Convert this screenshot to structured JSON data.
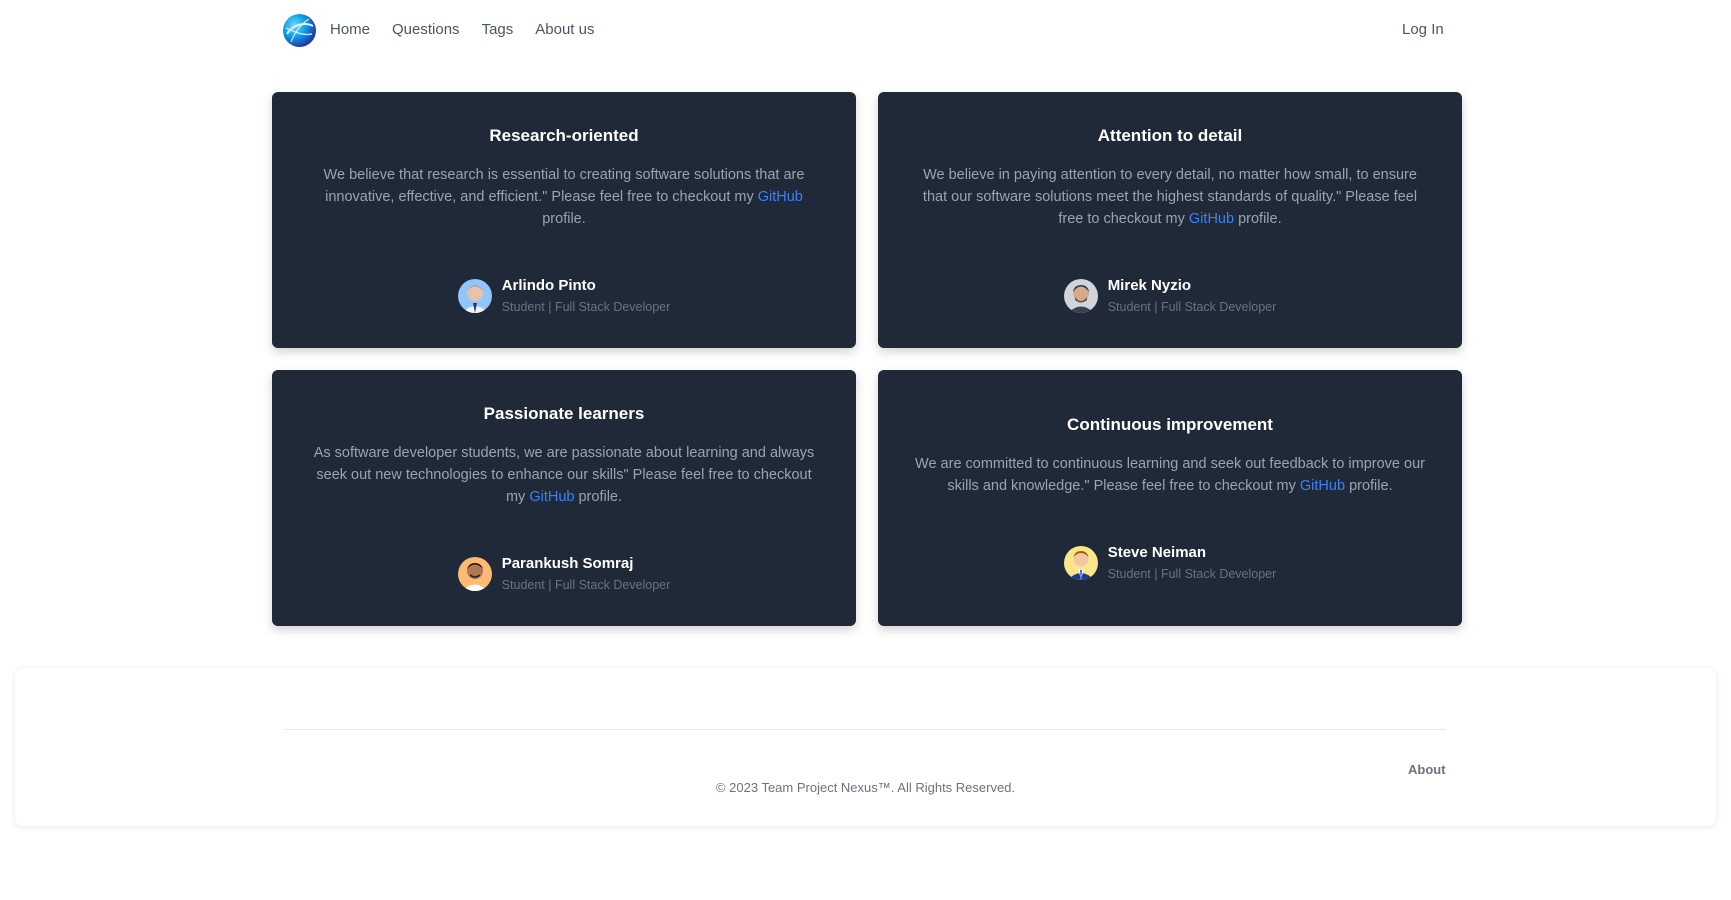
{
  "nav": {
    "logo_name": "globe-logo",
    "links": [
      "Home",
      "Questions",
      "Tags",
      "About us"
    ],
    "login": "Log In"
  },
  "cards": [
    {
      "title": "Research-oriented",
      "quote_before": "We believe that research is essential to creating software solutions that are innovative, effective, and efficient.\" Please feel free to checkout my ",
      "link_text": "GitHub",
      "quote_after": " profile.",
      "author_name": "Arlindo Pinto",
      "author_role": "Student | Full Stack Developer"
    },
    {
      "title": "Attention to detail",
      "quote_before": "We believe in paying attention to every detail, no matter how small, to ensure that our software solutions meet the highest standards of quality.\" Please feel free to checkout my ",
      "link_text": "GitHub",
      "quote_after": " profile.",
      "author_name": "Mirek Nyzio",
      "author_role": "Student | Full Stack Developer"
    },
    {
      "title": "Passionate learners",
      "quote_before": "As software developer students, we are passionate about learning and always seek out new technologies to enhance our skills\" Please feel free to checkout my ",
      "link_text": "GitHub",
      "quote_after": " profile.",
      "author_name": "Parankush Somraj",
      "author_role": "Student | Full Stack Developer"
    },
    {
      "title": "Continuous improvement",
      "quote_before": "We are committed to continuous learning and seek out feedback to improve our skills and knowledge.\" Please feel free to checkout my ",
      "link_text": "GitHub",
      "quote_after": " profile.",
      "author_name": "Steve Neiman",
      "author_role": "Student | Full Stack Developer"
    }
  ],
  "footer": {
    "about": "About",
    "copyright": "© 2023 Team Project Nexus™. All Rights Reserved."
  },
  "colors": {
    "card_bg": "#1f2937",
    "link": "#3b82f6",
    "muted": "#9ca3af"
  }
}
